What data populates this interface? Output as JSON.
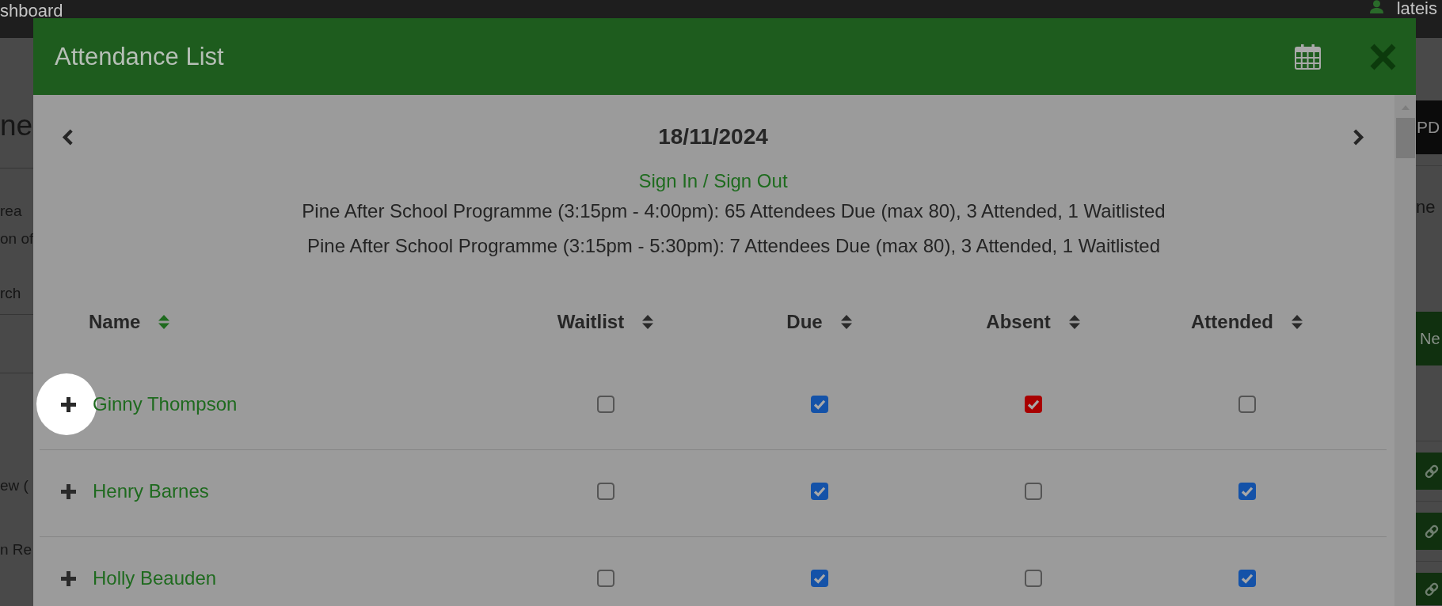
{
  "page_behind": {
    "top_bar": {
      "title": "shboard",
      "user_name": "lateis"
    },
    "heading": "ne",
    "intro_lines": [
      "rea",
      "on of"
    ],
    "search": {
      "placeholder": "rch"
    },
    "list_items": [
      "ew (",
      "n Re"
    ],
    "export_button": "PD",
    "side_note": "ne",
    "new_button": "Ne"
  },
  "dialog": {
    "title": "Attendance List",
    "date": "18/11/2024",
    "sign_link": "Sign In / Sign Out",
    "summaries": [
      "Pine After School Programme (3:15pm - 4:00pm): 65 Attendees Due (max 80), 3 Attended, 1 Waitlisted",
      "Pine After School Programme (3:15pm - 5:30pm): 7 Attendees Due (max 80), 3 Attended, 1 Waitlisted"
    ],
    "table": {
      "columns": [
        {
          "label": "Name",
          "sort_active": true
        },
        {
          "label": "Waitlist",
          "sort_active": false
        },
        {
          "label": "Due",
          "sort_active": false
        },
        {
          "label": "Absent",
          "sort_active": false
        },
        {
          "label": "Attended",
          "sort_active": false
        }
      ],
      "rows": [
        {
          "name": "Ginny Thompson",
          "highlighted": true,
          "waitlist": false,
          "due": true,
          "absent": true,
          "attended": false
        },
        {
          "name": "Henry Barnes",
          "highlighted": false,
          "waitlist": false,
          "due": true,
          "absent": false,
          "attended": true
        },
        {
          "name": "Holly Beauden",
          "highlighted": false,
          "waitlist": false,
          "due": true,
          "absent": false,
          "attended": true
        }
      ]
    }
  }
}
